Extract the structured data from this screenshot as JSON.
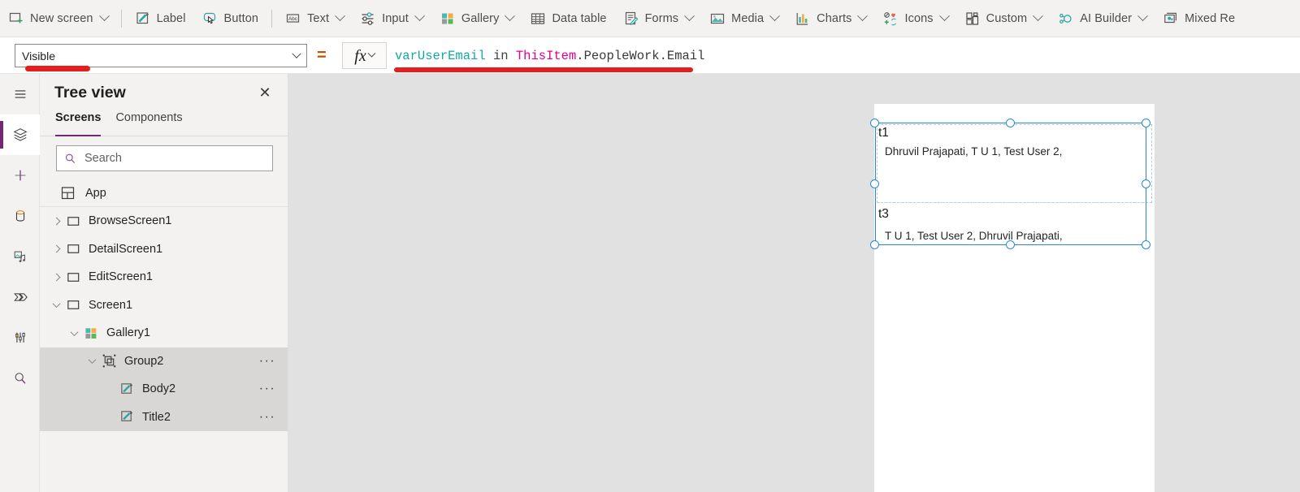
{
  "toolbar": {
    "items": [
      {
        "label": "New screen",
        "icon": "new-screen-icon",
        "caret": true
      },
      {
        "label": "Label",
        "icon": "label-icon",
        "caret": false
      },
      {
        "label": "Button",
        "icon": "button-icon",
        "caret": false
      },
      {
        "label": "Text",
        "icon": "text-icon",
        "caret": true
      },
      {
        "label": "Input",
        "icon": "input-icon",
        "caret": true
      },
      {
        "label": "Gallery",
        "icon": "gallery-icon",
        "caret": true
      },
      {
        "label": "Data table",
        "icon": "data-table-icon",
        "caret": false
      },
      {
        "label": "Forms",
        "icon": "forms-icon",
        "caret": true
      },
      {
        "label": "Media",
        "icon": "media-icon",
        "caret": true
      },
      {
        "label": "Charts",
        "icon": "charts-icon",
        "caret": true
      },
      {
        "label": "Icons",
        "icon": "icons-icon",
        "caret": true
      },
      {
        "label": "Custom",
        "icon": "custom-icon",
        "caret": true
      },
      {
        "label": "AI Builder",
        "icon": "ai-builder-icon",
        "caret": true
      },
      {
        "label": "Mixed Re",
        "icon": "mixed-reality-icon",
        "caret": false
      }
    ]
  },
  "formula_bar": {
    "property": "Visible",
    "equals": "=",
    "fx_label": "fx",
    "formula_tokens": [
      {
        "text": "varUserEmail",
        "cls": "tk-var"
      },
      {
        "text": " ",
        "cls": "tk-plain"
      },
      {
        "text": "in",
        "cls": "tk-op"
      },
      {
        "text": " ",
        "cls": "tk-plain"
      },
      {
        "text": "ThisItem",
        "cls": "tk-this"
      },
      {
        "text": ".PeopleWork.Email",
        "cls": "tk-plain"
      }
    ],
    "formula_plain": "varUserEmail in ThisItem.PeopleWork.Email",
    "accent_equals_color": "#c25100"
  },
  "rail": {
    "items": [
      {
        "name": "menu-icon",
        "active": false
      },
      {
        "name": "tree-view-icon",
        "active": true
      },
      {
        "name": "insert-icon",
        "active": false
      },
      {
        "name": "data-sources-icon",
        "active": false
      },
      {
        "name": "media-library-icon",
        "active": false
      },
      {
        "name": "power-automate-icon",
        "active": false
      },
      {
        "name": "variables-icon",
        "active": false
      },
      {
        "name": "search-icon",
        "active": false
      }
    ],
    "active_indicator_color": "#742774"
  },
  "tree_view": {
    "title": "Tree view",
    "close_label": "✕",
    "tabs": [
      {
        "label": "Screens",
        "selected": true
      },
      {
        "label": "Components",
        "selected": false
      }
    ],
    "search": {
      "placeholder": "Search",
      "value": ""
    },
    "app_row": {
      "label": "App",
      "icon": "app-icon"
    },
    "nodes": [
      {
        "label": "BrowseScreen1",
        "icon": "screen-icon",
        "twist": "right",
        "indent": 0,
        "selected": false,
        "ellipsis": false
      },
      {
        "label": "DetailScreen1",
        "icon": "screen-icon",
        "twist": "right",
        "indent": 0,
        "selected": false,
        "ellipsis": false
      },
      {
        "label": "EditScreen1",
        "icon": "screen-icon",
        "twist": "right",
        "indent": 0,
        "selected": false,
        "ellipsis": false
      },
      {
        "label": "Screen1",
        "icon": "screen-icon",
        "twist": "down",
        "indent": 0,
        "selected": false,
        "ellipsis": false
      },
      {
        "label": "Gallery1",
        "icon": "gallery-node-icon",
        "twist": "down",
        "indent": 1,
        "selected": false,
        "ellipsis": false
      },
      {
        "label": "Group2",
        "icon": "group-icon",
        "twist": "down",
        "indent": 2,
        "selected": true,
        "ellipsis": true
      },
      {
        "label": "Body2",
        "icon": "label-node-icon",
        "twist": "none",
        "indent": 3,
        "selected": true,
        "ellipsis": true
      },
      {
        "label": "Title2",
        "icon": "label-node-icon",
        "twist": "none",
        "indent": 3,
        "selected": true,
        "ellipsis": true
      }
    ],
    "ellipsis_label": "···",
    "selection_color": "#d9d7d5"
  },
  "canvas": {
    "background": "#e1e1e1",
    "screen_background": "#ffffff",
    "selection_color": "#2b88d8",
    "gallery_items": [
      {
        "title": "t1",
        "body": "Dhruvil Prajapati, T U 1, Test User 2,"
      },
      {
        "title": "t3",
        "body": "T U 1, Test User 2, Dhruvil Prajapati,"
      }
    ]
  },
  "annotations": {
    "color": "#e81c1c",
    "marks": [
      {
        "name": "redmark-visible",
        "target": "Visible"
      },
      {
        "name": "redmark-formula",
        "target": "varUserEmail in ThisItem.PeopleWork.Email"
      }
    ]
  }
}
